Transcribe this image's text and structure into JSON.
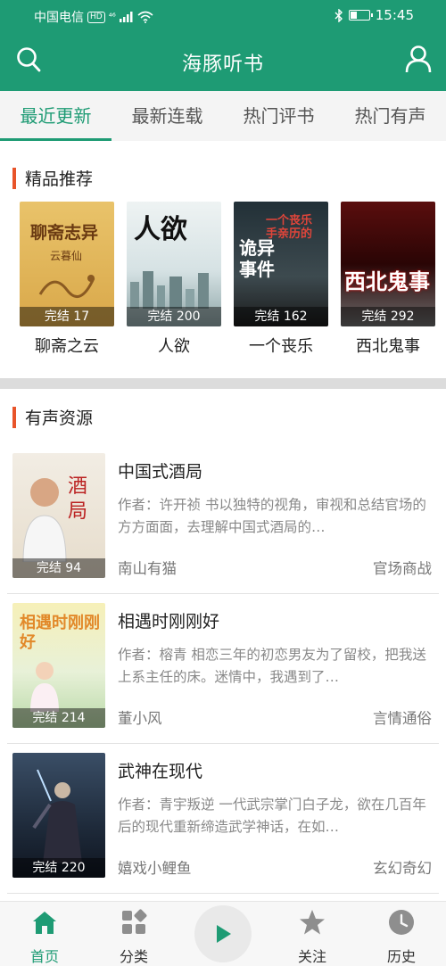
{
  "status": {
    "carrier": "中国电信",
    "hd": "HD",
    "network": "⁴⁶",
    "time": "15:45",
    "battery_level": 0.35
  },
  "header": {
    "title": "海豚听书",
    "search_icon": "search-icon",
    "user_icon": "user-icon"
  },
  "tabs": [
    {
      "label": "最近更新",
      "active": true
    },
    {
      "label": "最新连载",
      "active": false
    },
    {
      "label": "热门评书",
      "active": false
    },
    {
      "label": "热门有声",
      "active": false
    }
  ],
  "featured": {
    "title": "精品推荐",
    "books": [
      {
        "name": "聊斋之云",
        "badge": "完结 17",
        "cover_text": "聊斋志异",
        "cover_sub": "云暮仙"
      },
      {
        "name": "人欲",
        "badge": "完结 200",
        "cover_text": "人欲",
        "cover_sub": ""
      },
      {
        "name": "一个丧乐",
        "badge": "完结 162",
        "cover_text": "诡异事件",
        "cover_sub": "一个丧乐手亲历的"
      },
      {
        "name": "西北鬼事",
        "badge": "完结 292",
        "cover_text": "西北鬼事",
        "cover_sub": ""
      }
    ]
  },
  "audio": {
    "title": "有声资源",
    "items": [
      {
        "title": "中国式酒局",
        "badge": "完结 94",
        "desc": "作者：许开祯 书以独特的视角，审视和总结官场的方方面面，去理解中国式酒局的…",
        "anchor": "南山有猫",
        "category": "官场商战",
        "cover_text": "酒局"
      },
      {
        "title": "相遇时刚刚好",
        "badge": "完结 214",
        "desc": "作者：榕青 相恋三年的初恋男友为了留校，把我送上系主任的床。迷情中，我遇到了…",
        "anchor": "董小风",
        "category": "言情通俗",
        "cover_text": "相遇时刚刚好"
      },
      {
        "title": "武神在现代",
        "badge": "完结 220",
        "desc": "作者：青宇叛逆 一代武宗掌门白子龙，欲在几百年后的现代重新缔造武学神话，在如…",
        "anchor": "嬉戏小鲤鱼",
        "category": "玄幻奇幻",
        "cover_text": ""
      }
    ]
  },
  "nav": [
    {
      "label": "首页",
      "icon": "home-icon",
      "active": true
    },
    {
      "label": "分类",
      "icon": "category-icon",
      "active": false
    },
    {
      "label": "",
      "icon": "play-icon",
      "active": false
    },
    {
      "label": "关注",
      "icon": "star-icon",
      "active": false
    },
    {
      "label": "历史",
      "icon": "clock-icon",
      "active": false
    }
  ],
  "colors": {
    "brand": "#1e9b74",
    "accent": "#e8542a"
  }
}
